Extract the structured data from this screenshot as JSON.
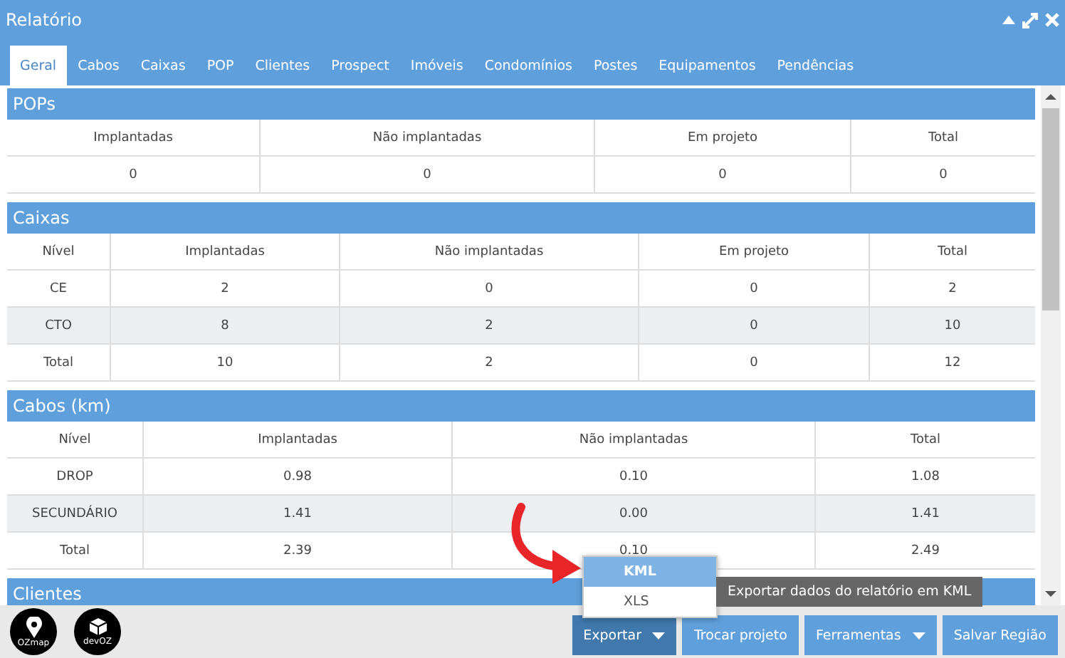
{
  "window": {
    "title": "Relatório"
  },
  "tabs": [
    {
      "label": "Geral",
      "selected": true
    },
    {
      "label": "Cabos",
      "selected": false
    },
    {
      "label": "Caixas",
      "selected": false
    },
    {
      "label": "POP",
      "selected": false
    },
    {
      "label": "Clientes",
      "selected": false
    },
    {
      "label": "Prospect",
      "selected": false
    },
    {
      "label": "Imóveis",
      "selected": false
    },
    {
      "label": "Condomínios",
      "selected": false
    },
    {
      "label": "Postes",
      "selected": false
    },
    {
      "label": "Equipamentos",
      "selected": false
    },
    {
      "label": "Pendências",
      "selected": false
    }
  ],
  "sections": [
    {
      "title": "POPs",
      "columns": [
        "Implantadas",
        "Não implantadas",
        "Em projeto",
        "Total"
      ],
      "rows": [
        [
          "0",
          "0",
          "0",
          "0"
        ]
      ]
    },
    {
      "title": "Caixas",
      "columns": [
        "Nível",
        "Implantadas",
        "Não implantadas",
        "Em projeto",
        "Total"
      ],
      "rows": [
        [
          "CE",
          "2",
          "0",
          "0",
          "2"
        ],
        [
          "CTO",
          "8",
          "2",
          "0",
          "10"
        ],
        [
          "Total",
          "10",
          "2",
          "0",
          "12"
        ]
      ]
    },
    {
      "title": "Cabos (km)",
      "columns": [
        "Nível",
        "Implantadas",
        "Não implantadas",
        "Total"
      ],
      "rows": [
        [
          "DROP",
          "0.98",
          "0.10",
          "1.08"
        ],
        [
          "SECUNDÁRIO",
          "1.41",
          "0.00",
          "1.41"
        ],
        [
          "Total",
          "2.39",
          "0.10",
          "2.49"
        ]
      ]
    },
    {
      "title": "Clientes"
    }
  ],
  "logos": [
    {
      "label": "OZmap"
    },
    {
      "label": "devOZ"
    }
  ],
  "buttons": [
    {
      "label": "Exportar",
      "kind": "dropdown",
      "pressed": true
    },
    {
      "label": "Trocar projeto",
      "kind": "plain",
      "pressed": false
    },
    {
      "label": "Ferramentas",
      "kind": "dropdown",
      "pressed": false
    },
    {
      "label": "Salvar Região",
      "kind": "plain",
      "pressed": false
    }
  ],
  "export_menu": {
    "items": [
      {
        "label": "KML",
        "selected": true
      },
      {
        "label": "XLS",
        "selected": false
      }
    ]
  },
  "tooltip": "Exportar dados do relatório em KML"
}
